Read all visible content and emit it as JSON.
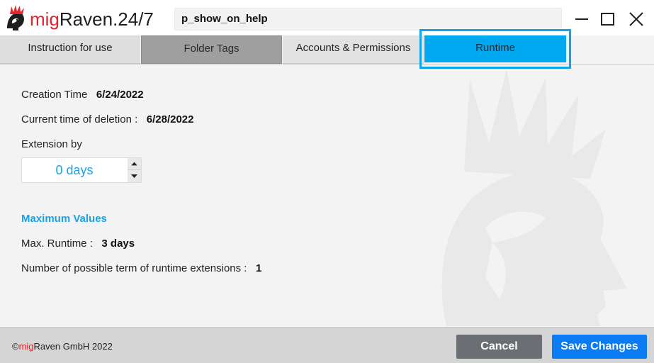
{
  "app": {
    "brand_prefix": "mig",
    "brand_rest": "Raven.24/7",
    "window_title": "p_show_on_help"
  },
  "tabs": [
    {
      "label": "Instruction for use"
    },
    {
      "label": "Folder Tags"
    },
    {
      "label": "Accounts & Permissions"
    },
    {
      "label": "Runtime",
      "selected": true
    }
  ],
  "runtime": {
    "creation_label": "Creation Time",
    "creation_value": "6/24/2022",
    "deletion_label": "Current time of deletion :",
    "deletion_value": "6/28/2022",
    "extension_label": "Extension by",
    "extension_value": "0 days",
    "max_title": "Maximum Values",
    "max_runtime_label": "Max. Runtime :",
    "max_runtime_value": "3 days",
    "extensions_label": "Number of possible term of runtime extensions :",
    "extensions_value": "1"
  },
  "footer": {
    "copyright_symbol": "©",
    "copyright_brand": "mig",
    "copyright_rest": "Raven GmbH 2022",
    "cancel_label": "Cancel",
    "save_label": "Save Changes"
  },
  "colors": {
    "accent": "#00a8ef",
    "brand_red": "#e3242b",
    "save_button": "#0a7bf2",
    "cancel_button": "#6b6f74"
  },
  "icons": [
    "migraven-logo-icon",
    "minimize-icon",
    "maximize-icon",
    "close-icon",
    "chevron-up-icon",
    "chevron-down-icon",
    "raven-watermark-icon"
  ]
}
